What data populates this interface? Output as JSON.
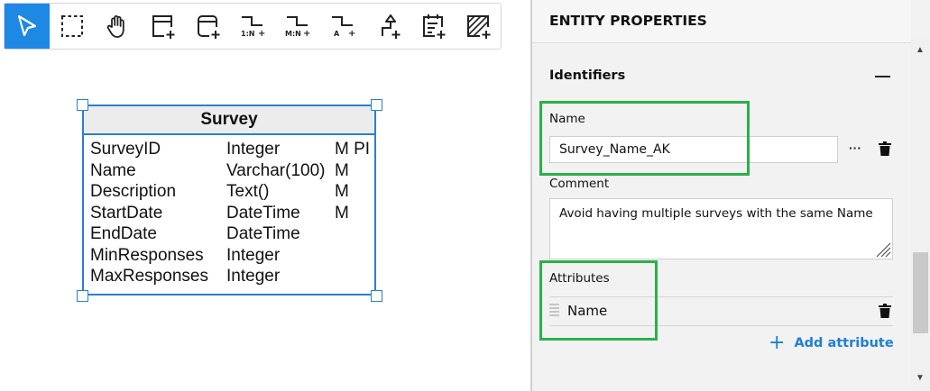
{
  "toolbar": {
    "tools": [
      {
        "icon": "pointer-icon",
        "active": true
      },
      {
        "icon": "marquee-select-icon"
      },
      {
        "icon": "hand-pan-icon"
      },
      {
        "icon": "add-table-icon"
      },
      {
        "icon": "add-rounded-table-icon"
      },
      {
        "icon": "relation-one-to-many-icon",
        "caption": "1:N"
      },
      {
        "icon": "relation-many-to-many-icon",
        "caption": "M:N"
      },
      {
        "icon": "association-icon",
        "caption": "A"
      },
      {
        "icon": "inheritance-icon"
      },
      {
        "icon": "add-note-icon"
      },
      {
        "icon": "add-area-icon"
      }
    ]
  },
  "entity": {
    "title": "Survey",
    "attributes": [
      {
        "name": "SurveyID",
        "type": "Integer",
        "flags": "M PI"
      },
      {
        "name": "Name",
        "type": "Varchar(100)",
        "flags": "M"
      },
      {
        "name": "Description",
        "type": "Text()",
        "flags": "M"
      },
      {
        "name": "StartDate",
        "type": "DateTime",
        "flags": "M"
      },
      {
        "name": "EndDate",
        "type": "DateTime",
        "flags": ""
      },
      {
        "name": "MinResponses",
        "type": "Integer",
        "flags": ""
      },
      {
        "name": "MaxResponses",
        "type": "Integer",
        "flags": ""
      }
    ]
  },
  "panel": {
    "title": "ENTITY PROPERTIES",
    "section_title": "Identifiers",
    "name_label": "Name",
    "name_value": "Survey_Name_AK",
    "more_label": "···",
    "comment_label": "Comment",
    "comment_value": "Avoid having multiple surveys with the same Name",
    "attributes_label": "Attributes",
    "attribute_items": [
      "Name"
    ],
    "add_attribute_label": "Add attribute",
    "add_icon_glyph": "+"
  },
  "colors": {
    "accent": "#1e88e5",
    "entity_border": "#2a7fd4",
    "highlight": "#2ab04a",
    "link": "#1e7fd6"
  }
}
